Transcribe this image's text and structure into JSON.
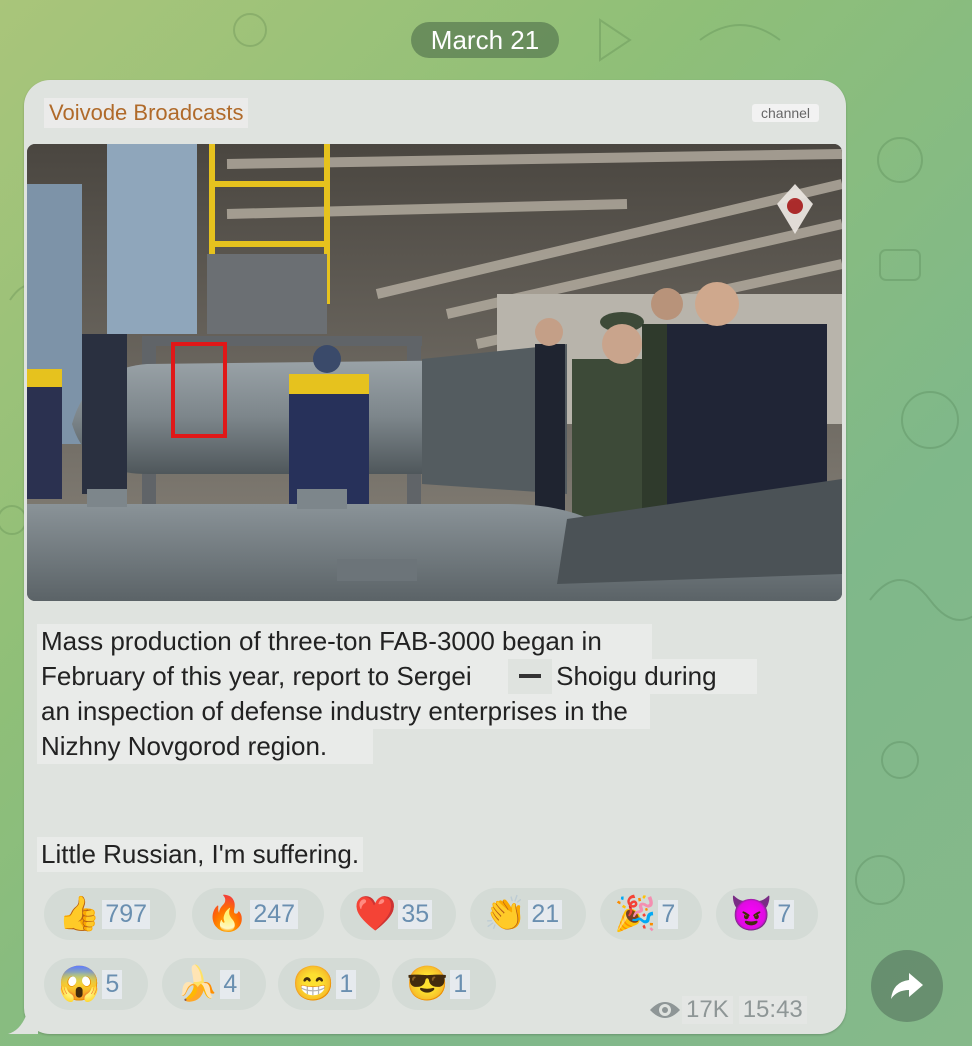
{
  "date_label": "March 21",
  "post": {
    "channel_name": "Voivode Broadcasts",
    "channel_tag": "channel",
    "text_lines": [
      "Mass production of three-ton FAB-3000 began in",
      "February of this year, report to Sergei",
      "Shoigu during",
      "an inspection of defense industry enterprises in the",
      "Nizhny Novgorod region."
    ],
    "text_footer": "Little Russian, I'm suffering.",
    "views": "17K",
    "time": "15:43"
  },
  "reactions": [
    {
      "emoji": "👍",
      "count": "797",
      "icon": "thumbs-up-icon"
    },
    {
      "emoji": "🔥",
      "count": "247",
      "icon": "fire-icon"
    },
    {
      "emoji": "❤️",
      "count": "35",
      "icon": "heart-icon"
    },
    {
      "emoji": "👏",
      "count": "21",
      "icon": "clapping-hands-icon"
    },
    {
      "emoji": "🎉",
      "count": "7",
      "icon": "party-popper-icon"
    },
    {
      "emoji": "😈",
      "count": "7",
      "icon": "smiling-devil-icon"
    },
    {
      "emoji": "😱",
      "count": "5",
      "icon": "screaming-face-icon"
    },
    {
      "emoji": "🍌",
      "count": "4",
      "icon": "banana-icon"
    },
    {
      "emoji": "😁",
      "count": "1",
      "icon": "grinning-face-icon"
    },
    {
      "emoji": "😎",
      "count": "1",
      "icon": "sunglasses-face-icon"
    }
  ],
  "colors": {
    "channel_name": "#b06a2a",
    "reaction_count": "#6a8fb0",
    "bubble": "#dfe3df"
  }
}
